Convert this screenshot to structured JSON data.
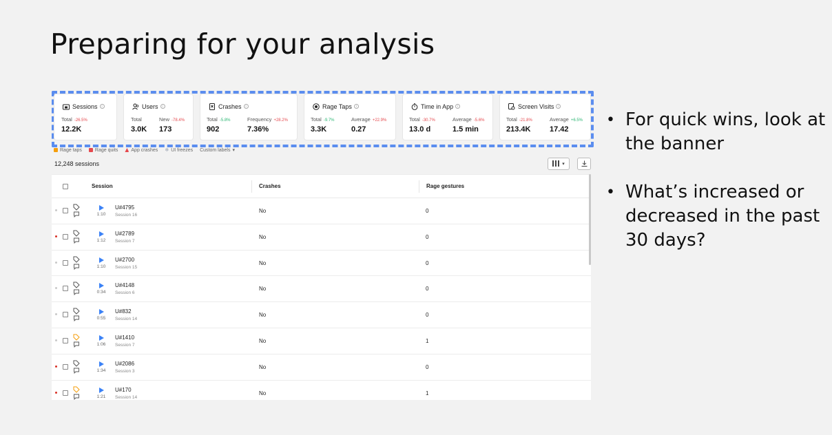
{
  "slide": {
    "title": "Preparing for your analysis",
    "bullets": [
      "For quick wins, look at the banner",
      "What’s increased or decreased in the past 30 days?"
    ]
  },
  "banner": {
    "cards": [
      {
        "title": "Sessions",
        "icon": "phone-lock-icon",
        "m1_label": "Total",
        "m1_delta": "-26.5%",
        "m1_delta_color": "#e5484d",
        "m1_value": "12.2K",
        "m2_label": "",
        "m2_delta": "",
        "m2_value": ""
      },
      {
        "title": "Users",
        "icon": "users-icon",
        "m1_label": "Total",
        "m1_delta": "",
        "m1_value": "3.0K",
        "m2_label": "New",
        "m2_delta": "-78.4%",
        "m2_delta_color": "#e5484d",
        "m2_value": "173"
      },
      {
        "title": "Crashes",
        "icon": "crash-icon",
        "m1_label": "Total",
        "m1_delta": "-5.8%",
        "m1_delta_color": "#2bb673",
        "m1_value": "902",
        "m2_label": "Frequency",
        "m2_delta": "+28.2%",
        "m2_delta_color": "#e5484d",
        "m2_value": "7.36%"
      },
      {
        "title": "Rage Taps",
        "icon": "rage-tap-icon",
        "m1_label": "Total",
        "m1_delta": "-9.7%",
        "m1_delta_color": "#2bb673",
        "m1_value": "3.3K",
        "m2_label": "Average",
        "m2_delta": "+22.9%",
        "m2_delta_color": "#e5484d",
        "m2_value": "0.27"
      },
      {
        "title": "Time in App",
        "icon": "stopwatch-icon",
        "m1_label": "Total",
        "m1_delta": "-30.7%",
        "m1_delta_color": "#e5484d",
        "m1_value": "13.0 d",
        "m2_label": "Average",
        "m2_delta": "-5.6%",
        "m2_delta_color": "#e5484d",
        "m2_value": "1.5 min"
      },
      {
        "title": "Screen Visits",
        "icon": "screen-visits-icon",
        "m1_label": "Total",
        "m1_delta": "-21.8%",
        "m1_delta_color": "#e5484d",
        "m1_value": "213.4K",
        "m2_label": "Average",
        "m2_delta": "+6.5%",
        "m2_delta_color": "#2bb673",
        "m2_value": "17.42"
      }
    ]
  },
  "filters": [
    {
      "label": "Rage taps",
      "color": "#f59e0b"
    },
    {
      "label": "Rage quits",
      "color": "#e5484d"
    },
    {
      "label": "App crashes",
      "color": "#e5484d"
    },
    {
      "label": "UI freezes",
      "color": "#9aa4b2"
    },
    {
      "label": "Custom labels",
      "color": ""
    }
  ],
  "session_count": "12,248 sessions",
  "table": {
    "headers": {
      "session": "Session",
      "crashes": "Crashes",
      "rage": "Rage gestures"
    },
    "rows": [
      {
        "status": "#c8c8c8",
        "tag_color": "#555",
        "uid": "U#4795",
        "session": "Session 16",
        "duration": "1:10",
        "crashes": "No",
        "rage": "0"
      },
      {
        "status": "#d93025",
        "tag_color": "#555",
        "uid": "U#2789",
        "session": "Session 7",
        "duration": "1:12",
        "crashes": "No",
        "rage": "0"
      },
      {
        "status": "#c8c8c8",
        "tag_color": "#555",
        "uid": "U#2700",
        "session": "Session 15",
        "duration": "1:10",
        "crashes": "No",
        "rage": "0"
      },
      {
        "status": "#c8c8c8",
        "tag_color": "#555",
        "uid": "U#4148",
        "session": "Session 6",
        "duration": "0:34",
        "crashes": "No",
        "rage": "0"
      },
      {
        "status": "#c8c8c8",
        "tag_color": "#555",
        "uid": "U#832",
        "session": "Session 14",
        "duration": "0:55",
        "crashes": "No",
        "rage": "0"
      },
      {
        "status": "#c8c8c8",
        "tag_color": "#f59e0b",
        "uid": "U#1410",
        "session": "Session 7",
        "duration": "1:06",
        "crashes": "No",
        "rage": "1"
      },
      {
        "status": "#d93025",
        "tag_color": "#555",
        "uid": "U#2086",
        "session": "Session 3",
        "duration": "1:34",
        "crashes": "No",
        "rage": "0"
      },
      {
        "status": "#d93025",
        "tag_color": "#f59e0b",
        "uid": "U#170",
        "session": "Session 14",
        "duration": "1:21",
        "crashes": "No",
        "rage": "1"
      }
    ]
  }
}
